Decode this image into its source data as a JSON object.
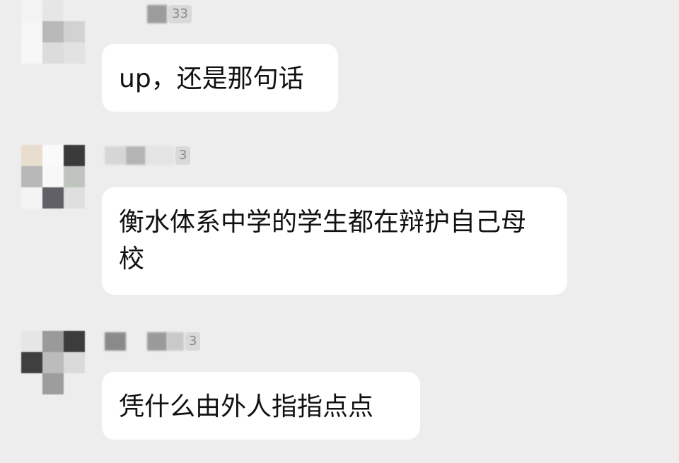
{
  "messages": [
    {
      "sender_suffix": "33",
      "text": "up，还是那句话"
    },
    {
      "sender_suffix": "3",
      "text": "衡水体系中学的学生都在辩护自己母校"
    },
    {
      "sender_suffix": "3",
      "text": "凭什么由外人指指点点"
    }
  ],
  "colors": {
    "background": "#ededed",
    "bubble": "#ffffff",
    "text": "#111111"
  }
}
